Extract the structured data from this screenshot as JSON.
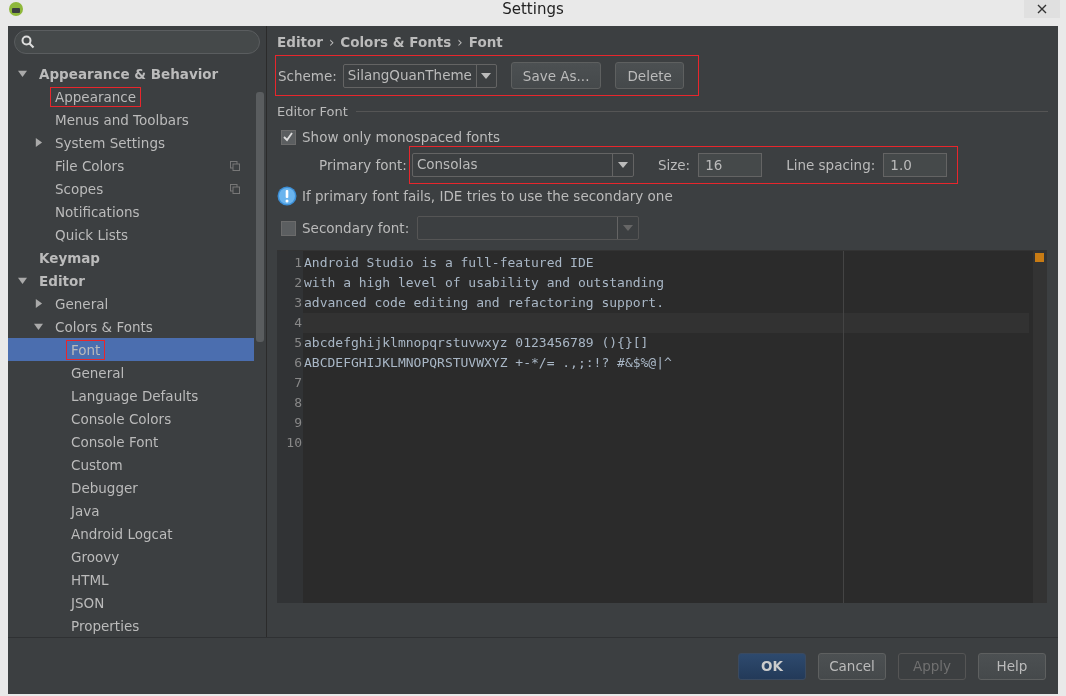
{
  "window": {
    "title": "Settings"
  },
  "sidebar": {
    "items": [
      {
        "label": "Appearance & Behavior",
        "expanded": true,
        "selected": false,
        "highlighted": false,
        "shared": false,
        "children": [
          {
            "label": "Appearance",
            "selected": false,
            "highlighted": true,
            "shared": false
          },
          {
            "label": "Menus and Toolbars",
            "selected": false,
            "highlighted": false,
            "shared": false
          },
          {
            "label": "System Settings",
            "expanded": false,
            "selected": false,
            "highlighted": false,
            "shared": false
          },
          {
            "label": "File Colors",
            "selected": false,
            "highlighted": false,
            "shared": true
          },
          {
            "label": "Scopes",
            "selected": false,
            "highlighted": false,
            "shared": true
          },
          {
            "label": "Notifications",
            "selected": false,
            "highlighted": false,
            "shared": false
          },
          {
            "label": "Quick Lists",
            "selected": false,
            "highlighted": false,
            "shared": false
          }
        ]
      },
      {
        "label": "Keymap",
        "selected": false,
        "highlighted": false,
        "shared": false
      },
      {
        "label": "Editor",
        "expanded": true,
        "selected": false,
        "highlighted": false,
        "shared": false,
        "children": [
          {
            "label": "General",
            "expanded": false,
            "selected": false,
            "highlighted": false,
            "shared": false
          },
          {
            "label": "Colors & Fonts",
            "expanded": true,
            "selected": false,
            "highlighted": false,
            "shared": false,
            "children": [
              {
                "label": "Font",
                "selected": true,
                "highlighted": true,
                "shared": false
              },
              {
                "label": "General",
                "selected": false,
                "highlighted": false,
                "shared": false
              },
              {
                "label": "Language Defaults",
                "selected": false,
                "highlighted": false,
                "shared": false
              },
              {
                "label": "Console Colors",
                "selected": false,
                "highlighted": false,
                "shared": false
              },
              {
                "label": "Console Font",
                "selected": false,
                "highlighted": false,
                "shared": false
              },
              {
                "label": "Custom",
                "selected": false,
                "highlighted": false,
                "shared": false
              },
              {
                "label": "Debugger",
                "selected": false,
                "highlighted": false,
                "shared": false
              },
              {
                "label": "Java",
                "selected": false,
                "highlighted": false,
                "shared": false
              },
              {
                "label": "Android Logcat",
                "selected": false,
                "highlighted": false,
                "shared": false
              },
              {
                "label": "Groovy",
                "selected": false,
                "highlighted": false,
                "shared": false
              },
              {
                "label": "HTML",
                "selected": false,
                "highlighted": false,
                "shared": false
              },
              {
                "label": "JSON",
                "selected": false,
                "highlighted": false,
                "shared": false
              },
              {
                "label": "Properties",
                "selected": false,
                "highlighted": false,
                "shared": false
              }
            ]
          }
        ]
      }
    ]
  },
  "breadcrumb": [
    "Editor",
    "Colors & Fonts",
    "Font"
  ],
  "breadcrumb_separator": "›",
  "scheme": {
    "label": "Scheme:",
    "value": "SilangQuanTheme",
    "highlighted": true,
    "buttons": [
      "Save As...",
      "Delete"
    ]
  },
  "editor_font": {
    "title": "Editor Font",
    "monospaced": {
      "label": "Show only monospaced fonts",
      "checked": true
    },
    "primary": {
      "label": "Primary font:",
      "value": "Consolas",
      "size_label": "Size:",
      "size": "16",
      "spacing_label": "Line spacing:",
      "spacing": "1.0",
      "highlighted": true
    },
    "info": "If primary font fails, IDE tries to use the secondary one",
    "secondary": {
      "label": "Secondary font:",
      "checked": false,
      "disabled": true
    }
  },
  "preview": {
    "lines": [
      {
        "number": "1",
        "text": "Android Studio is a full-featured IDE",
        "current": false
      },
      {
        "number": "2",
        "text": "with a high level of usability and outstanding",
        "current": false
      },
      {
        "number": "3",
        "text": "advanced code editing and refactoring support.",
        "current": false
      },
      {
        "number": "4",
        "current": true
      },
      {
        "number": "5",
        "text": "abcdefghijklmnopqrstuvwxyz 0123456789 (){}[]",
        "current": false
      },
      {
        "number": "6",
        "text": "ABCDEFGHIJKLMNOPQRSTUVWXYZ +-*/= .,;:!? #&$%@|^",
        "current": false
      },
      {
        "number": "7",
        "current": false
      },
      {
        "number": "8",
        "current": false
      },
      {
        "number": "9",
        "current": false
      },
      {
        "number": "10",
        "current": false
      }
    ]
  },
  "buttons": [
    {
      "label": "OK",
      "kind": "default",
      "disabled": false
    },
    {
      "label": "Cancel",
      "kind": "normal",
      "disabled": false
    },
    {
      "label": "Apply",
      "kind": "normal",
      "disabled": true
    },
    {
      "label": "Help",
      "kind": "normal",
      "disabled": false
    }
  ]
}
